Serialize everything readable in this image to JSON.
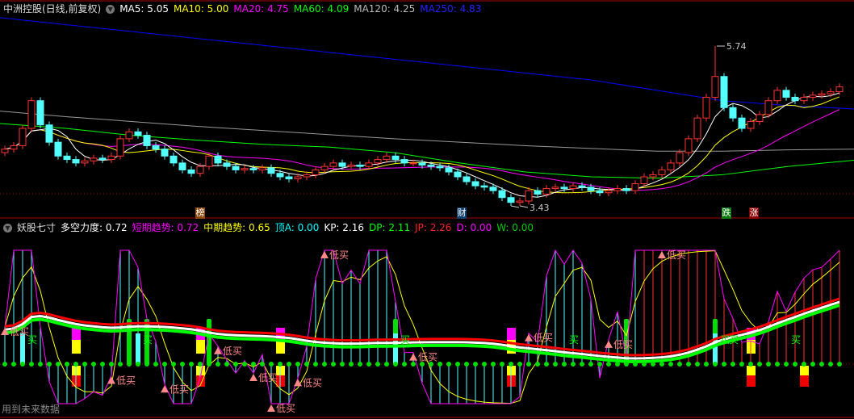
{
  "header": {
    "stock": "中洲控股(日线,前复权)",
    "ma5": "MA5: 5.05",
    "ma10": "MA10: 5.00",
    "ma20": "MA20: 4.75",
    "ma60": "MA60: 4.09",
    "ma120": "MA120: 4.25",
    "ma250": "MA250: 4.83"
  },
  "indicator_header": {
    "name": "妖股七寸",
    "dk": "多空力度: 0.72",
    "short": "短期趋势: 0.72",
    "mid": "中期趋势: 0.65",
    "top": "顶A: 0.00",
    "kp": "KP: 2.16",
    "dp": "DP: 2.11",
    "jp": "JP: 2.26",
    "d": "D: 0.00",
    "w": "W: 0.00"
  },
  "tags": {
    "bang": "榜",
    "cai": "财",
    "die": "跌",
    "zhang": "涨"
  },
  "footer": "用到未来数据",
  "colors": {
    "up": "#ff3232",
    "down": "#54ffff",
    "ma5": "#ffffff",
    "ma10": "#ffff00",
    "ma20": "#ff00ff",
    "ma60": "#00ff00",
    "ma120": "#999999",
    "ma250": "#0000ff"
  },
  "chart_data": {
    "type": "candlestick",
    "title": "中洲控股(日线,前复权)",
    "max_label": "5.74",
    "min_label": "3.43",
    "max_price": 5.74,
    "min_price": 3.43,
    "closes": [
      4.25,
      4.3,
      4.55,
      4.95,
      4.6,
      4.35,
      4.15,
      4.1,
      4.05,
      4.08,
      4.12,
      4.1,
      4.15,
      4.4,
      4.5,
      4.45,
      4.3,
      4.25,
      4.15,
      4.05,
      3.95,
      3.9,
      4.0,
      4.15,
      4.05,
      4.0,
      3.95,
      3.97,
      3.95,
      3.98,
      3.9,
      3.85,
      3.82,
      3.85,
      3.88,
      3.95,
      4.0,
      4.05,
      4.0,
      4.02,
      4.0,
      4.05,
      4.1,
      4.15,
      4.1,
      4.05,
      4.05,
      4.02,
      4.0,
      3.98,
      3.92,
      3.85,
      3.78,
      3.72,
      3.7,
      3.65,
      3.55,
      3.48,
      3.5,
      3.65,
      3.6,
      3.68,
      3.7,
      3.68,
      3.72,
      3.7,
      3.65,
      3.62,
      3.65,
      3.68,
      3.65,
      3.75,
      3.85,
      3.88,
      3.95,
      4.05,
      4.2,
      4.4,
      4.7,
      5.0,
      5.3,
      4.85,
      4.7,
      4.55,
      4.65,
      4.75,
      4.95,
      5.1,
      5.0,
      4.95,
      5.0,
      5.03,
      5.05,
      5.08,
      5.15
    ],
    "ma60": [
      4.62,
      4.55,
      4.45,
      4.38,
      4.32,
      4.28,
      4.2,
      4.05,
      3.92,
      3.85,
      3.83,
      3.88,
      4.0,
      4.09
    ],
    "ma120": [
      4.8,
      4.72,
      4.65,
      4.58,
      4.52,
      4.46,
      4.4,
      4.35,
      4.3,
      4.26,
      4.22,
      4.22,
      4.24,
      4.25
    ],
    "ma250": [
      6.15,
      6.05,
      5.95,
      5.85,
      5.75,
      5.65,
      5.55,
      5.45,
      5.35,
      5.25,
      5.1,
      4.95,
      4.88,
      4.83
    ],
    "signals": [
      {
        "i": 0,
        "t": "低买"
      },
      {
        "i": 12,
        "t": "低买"
      },
      {
        "i": 18,
        "t": "低买"
      },
      {
        "i": 24,
        "t": "低买"
      },
      {
        "i": 28,
        "t": "低买"
      },
      {
        "i": 30,
        "t": "低买"
      },
      {
        "i": 33,
        "t": "低买"
      },
      {
        "i": 36,
        "t": "低买"
      },
      {
        "i": 46,
        "t": "低买"
      },
      {
        "i": 59,
        "t": "低买"
      },
      {
        "i": 68,
        "t": "低买"
      },
      {
        "i": 74,
        "t": "低买"
      },
      {
        "i": 2,
        "t": "买"
      },
      {
        "i": 15,
        "t": "买"
      },
      {
        "i": 44,
        "t": "买"
      },
      {
        "i": 63,
        "t": "买"
      },
      {
        "i": 80,
        "t": "买"
      },
      {
        "i": 81,
        "t": "买"
      },
      {
        "i": 88,
        "t": "买"
      }
    ],
    "blocks_up": [
      8,
      22,
      31,
      57,
      84
    ],
    "blocks_down": [
      8,
      22,
      31,
      57,
      84,
      90
    ],
    "green_bars": [
      14,
      16,
      23,
      44,
      70,
      80
    ],
    "cyan_bars": [
      2,
      15,
      44,
      80
    ]
  }
}
